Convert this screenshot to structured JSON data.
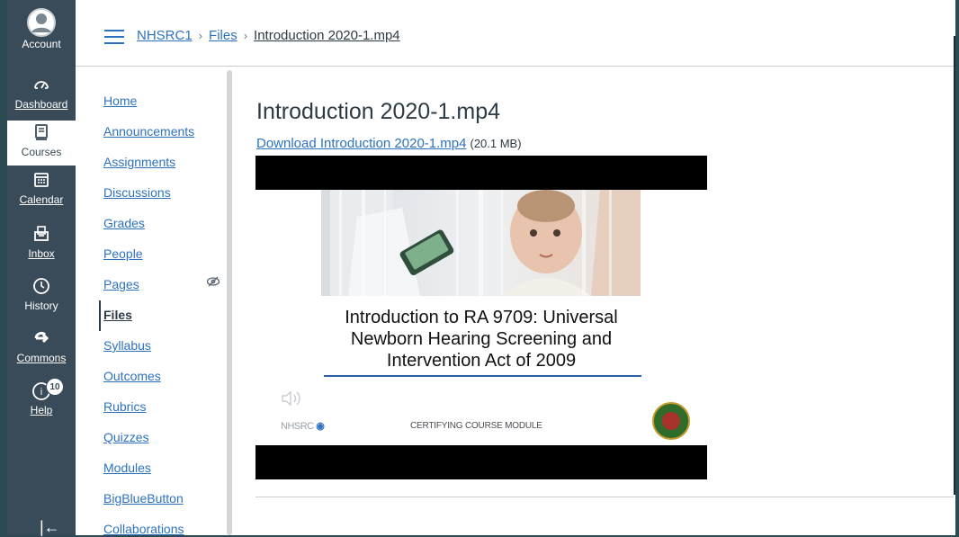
{
  "global_nav": {
    "items": [
      {
        "label": "Account",
        "icon": "account-avatar-icon"
      },
      {
        "label": "Dashboard",
        "icon": "dashboard-icon"
      },
      {
        "label": "Courses",
        "icon": "courses-icon"
      },
      {
        "label": "Calendar",
        "icon": "calendar-icon"
      },
      {
        "label": "Inbox",
        "icon": "inbox-icon"
      },
      {
        "label": "History",
        "icon": "history-icon"
      },
      {
        "label": "Commons",
        "icon": "commons-icon"
      },
      {
        "label": "Help",
        "icon": "help-icon",
        "badge": "10"
      }
    ],
    "collapse_glyph": "|←"
  },
  "breadcrumb": {
    "course": "NHSRC1",
    "section": "Files",
    "current": "Introduction 2020-1.mp4",
    "separator": "›"
  },
  "course_nav": {
    "items": [
      {
        "label": "Home"
      },
      {
        "label": "Announcements"
      },
      {
        "label": "Assignments"
      },
      {
        "label": "Discussions"
      },
      {
        "label": "Grades"
      },
      {
        "label": "People"
      },
      {
        "label": "Pages"
      },
      {
        "label": "Files"
      },
      {
        "label": "Syllabus"
      },
      {
        "label": "Outcomes"
      },
      {
        "label": "Rubrics"
      },
      {
        "label": "Quizzes"
      },
      {
        "label": "Modules"
      },
      {
        "label": "BigBlueButton"
      },
      {
        "label": "Collaborations"
      }
    ],
    "active": "Files",
    "hidden_glyph": "ø"
  },
  "file": {
    "title": "Introduction 2020-1.mp4",
    "download_label": "Download Introduction 2020-1.mp4",
    "size": "(20.1 MB)"
  },
  "video": {
    "slide_title_lines": [
      "Introduction to RA 9709: Universal",
      "Newborn Hearing Screening and",
      "Intervention Act of 2009"
    ],
    "logo_text": "NHSRC",
    "footer_text": "CERTIFYING COURSE MODULE",
    "speaker_glyph": "🔈"
  },
  "colors": {
    "nav_bg": "#394b58",
    "link": "#2d72bf",
    "text": "#2d3b45"
  }
}
